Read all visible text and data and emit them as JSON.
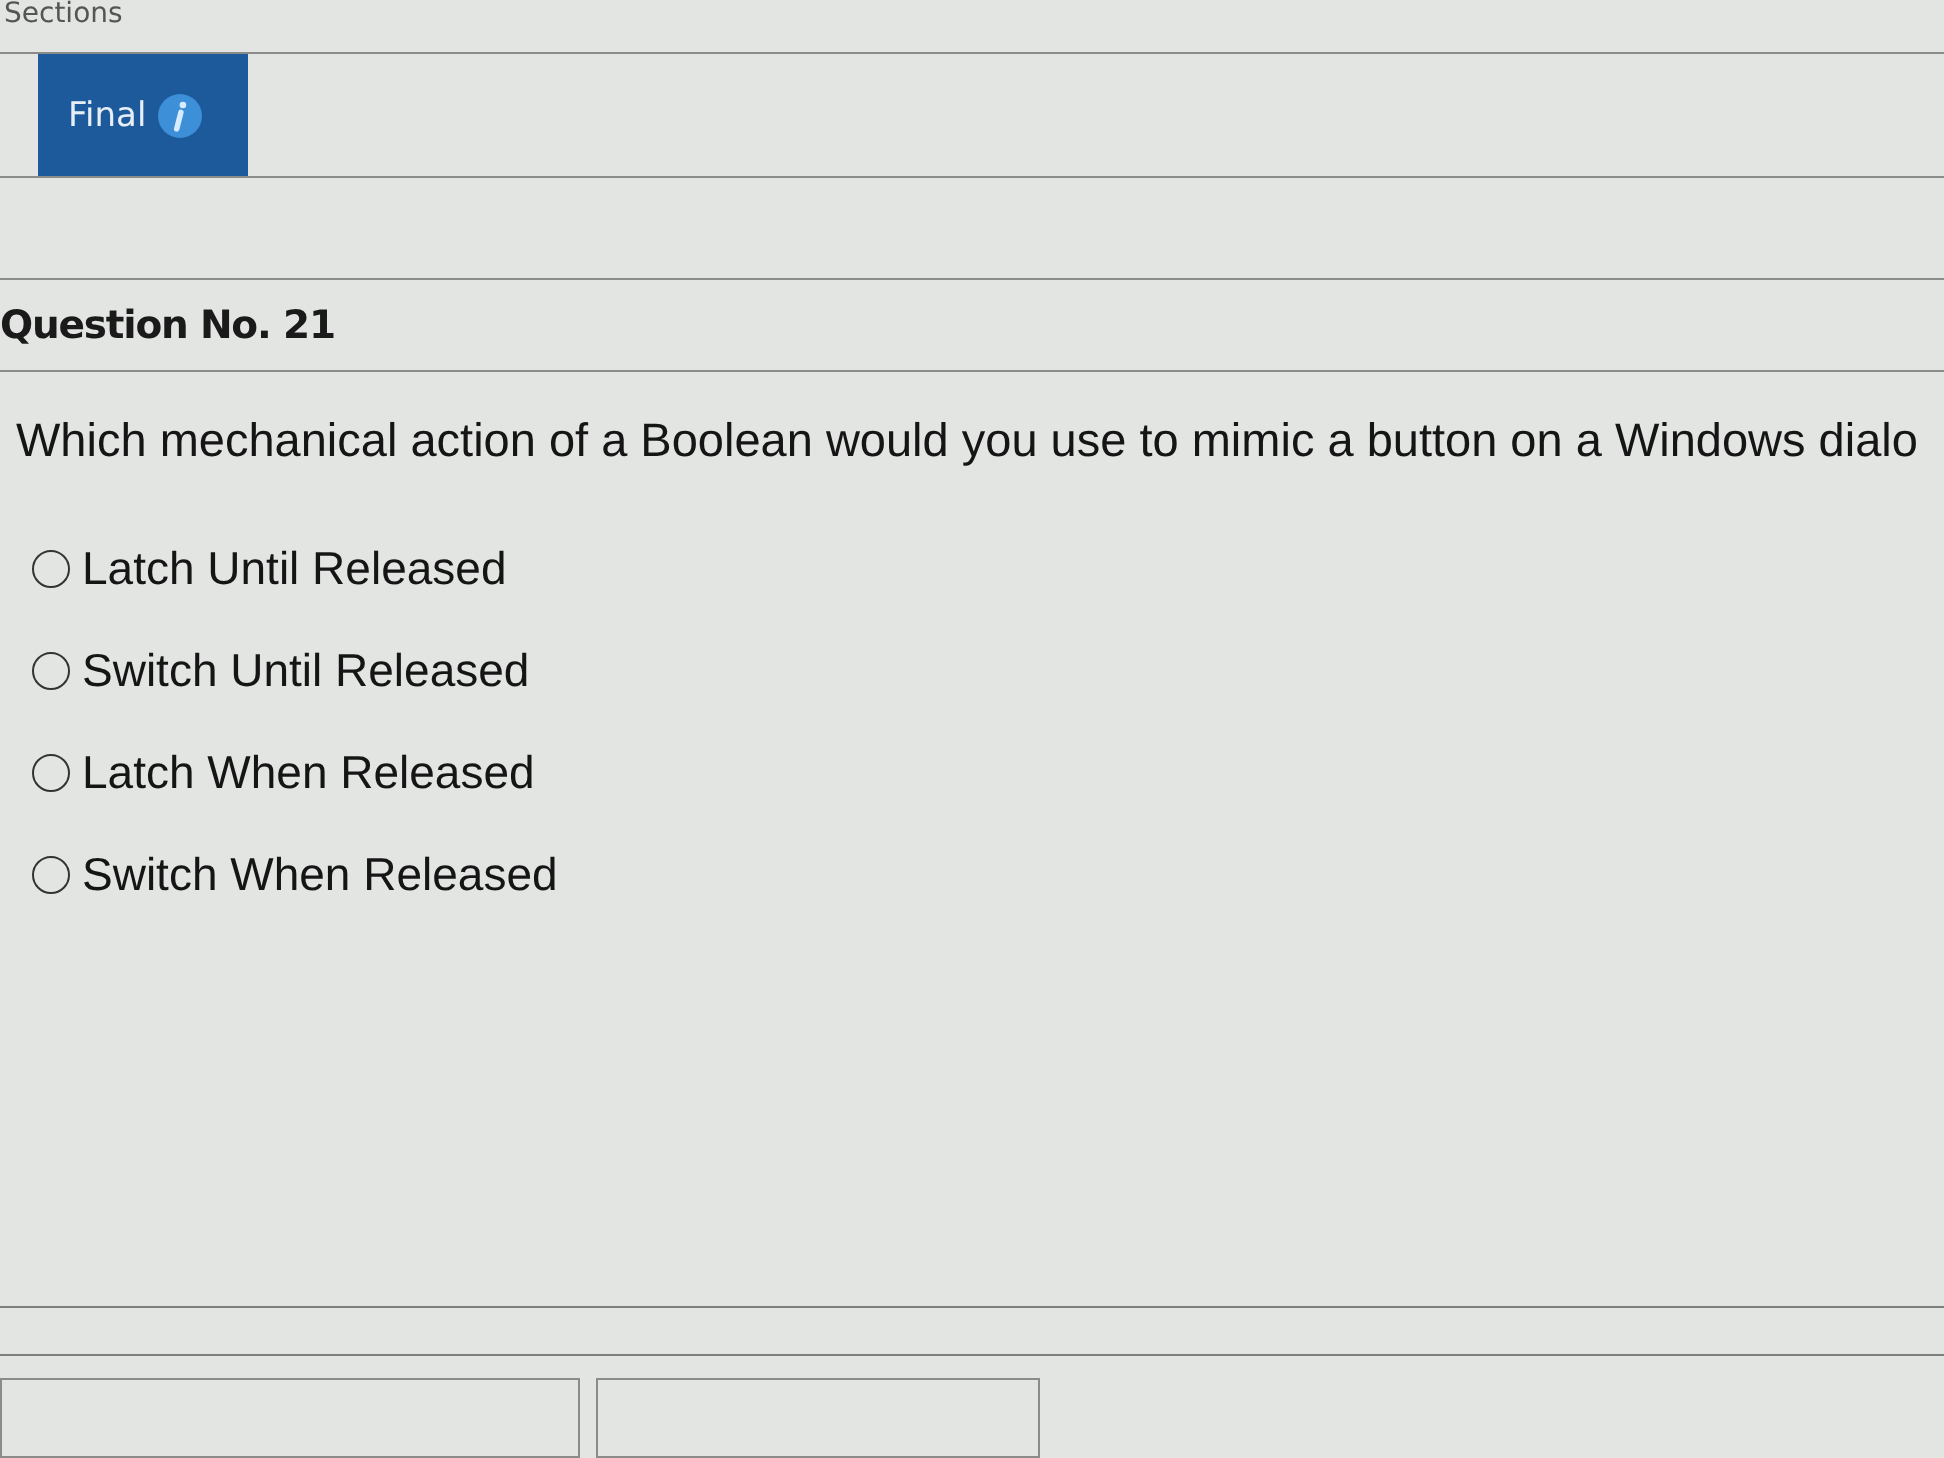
{
  "sections_label": "Sections",
  "tabs": [
    {
      "label": "Final",
      "selected": true
    }
  ],
  "question": {
    "heading": "Question No. 21",
    "text": "Which mechanical action of a Boolean would you use to mimic a button on a Windows dialo",
    "options": [
      {
        "label": "Latch Until Released",
        "selected": false
      },
      {
        "label": "Switch Until Released",
        "selected": false
      },
      {
        "label": "Latch When Released",
        "selected": false
      },
      {
        "label": "Switch When Released",
        "selected": false
      }
    ]
  },
  "footer_buttons": [
    {
      "kind": "wide"
    },
    {
      "kind": "narrow"
    }
  ]
}
